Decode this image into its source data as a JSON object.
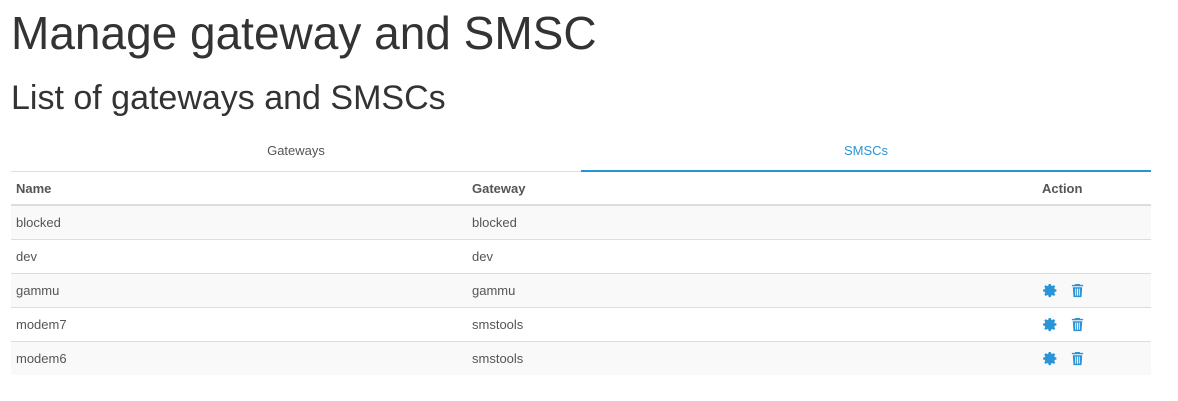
{
  "header": {
    "title": "Manage gateway and SMSC",
    "subtitle": "List of gateways and SMSCs"
  },
  "tabs": [
    {
      "label": "Gateways",
      "active": false
    },
    {
      "label": "SMSCs",
      "active": true
    }
  ],
  "table": {
    "columns": [
      "Name",
      "Gateway",
      "Action"
    ],
    "rows": [
      {
        "name": "blocked",
        "gateway": "blocked",
        "actions": []
      },
      {
        "name": "dev",
        "gateway": "dev",
        "actions": []
      },
      {
        "name": "gammu",
        "gateway": "gammu",
        "actions": [
          "gear-icon",
          "trash-icon"
        ]
      },
      {
        "name": "modem7",
        "gateway": "smstools",
        "actions": [
          "gear-icon",
          "trash-icon"
        ]
      },
      {
        "name": "modem6",
        "gateway": "smstools",
        "actions": [
          "gear-icon",
          "trash-icon"
        ]
      }
    ]
  },
  "colors": {
    "accent": "#2a94d6",
    "text": "#333333",
    "muted": "#555555",
    "border": "#dddddd",
    "stripe": "#f9f9f9"
  }
}
